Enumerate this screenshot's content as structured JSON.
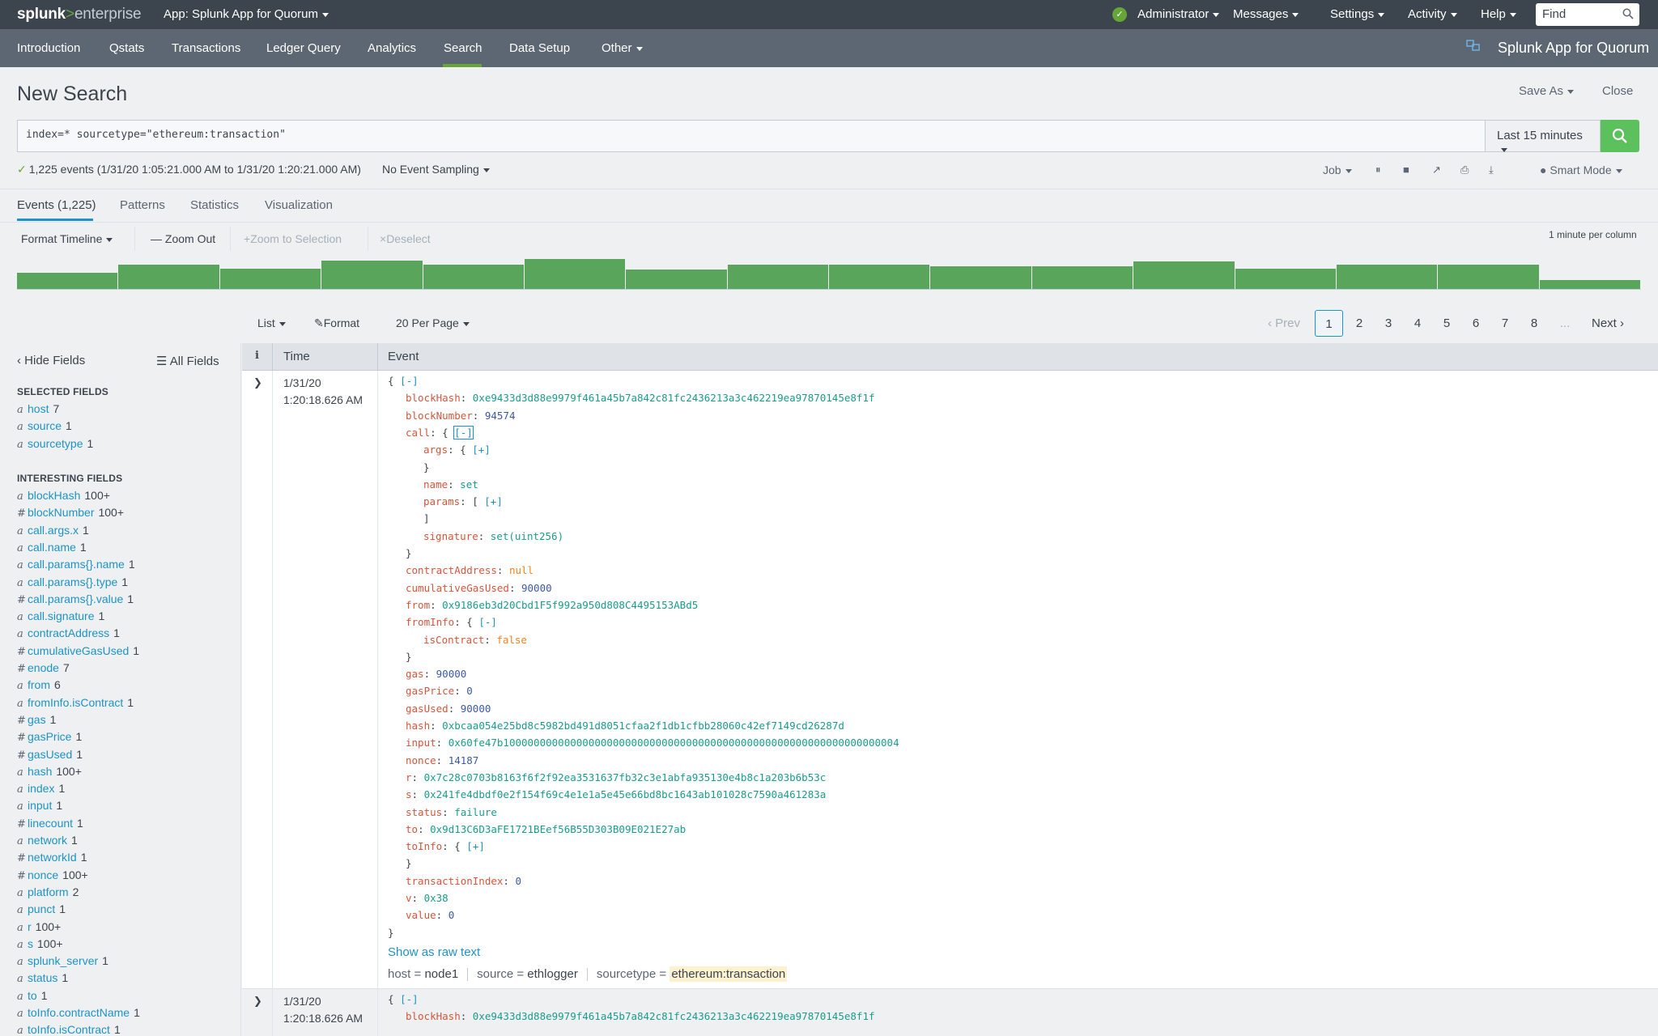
{
  "topbar": {
    "logo_brand": "splunk",
    "logo_gt": ">",
    "logo_product": "enterprise",
    "app_menu": "App: Splunk App for Quorum",
    "menus": [
      "Administrator",
      "Messages",
      "Settings",
      "Activity",
      "Help"
    ],
    "find_placeholder": "Find"
  },
  "appnav": {
    "items": [
      "Introduction",
      "Qstats",
      "Transactions",
      "Ledger Query",
      "Analytics",
      "Search",
      "Data Setup",
      "Other"
    ],
    "active": "Search",
    "app_title": "Splunk App for Quorum"
  },
  "header": {
    "title": "New Search",
    "save_as": "Save As",
    "close": "Close"
  },
  "search": {
    "query": "index=* sourcetype=\"ethereum:transaction\"",
    "time_range": "Last 15 minutes"
  },
  "status": {
    "summary": "1,225 events (1/31/20 1:05:21.000 AM to 1/31/20 1:20:21.000 AM)",
    "sampling": "No Event Sampling",
    "job": "Job",
    "mode": "Smart Mode"
  },
  "tabs": [
    "Events (1,225)",
    "Patterns",
    "Statistics",
    "Visualization"
  ],
  "timeline": {
    "format": "Format Timeline",
    "zoom_out": "Zoom Out",
    "zoom_selection": "Zoom to Selection",
    "deselect": "Deselect",
    "scale": "1 minute per column",
    "bars": [
      0.55,
      0.82,
      0.68,
      0.95,
      0.8,
      1.0,
      0.65,
      0.82,
      0.8,
      0.75,
      0.75,
      0.92,
      0.68,
      0.82,
      0.8,
      0.3
    ]
  },
  "results_toolbar": {
    "list": "List",
    "format": "Format",
    "per_page": "20 Per Page",
    "prev": "Prev",
    "pages": [
      "1",
      "2",
      "3",
      "4",
      "5",
      "6",
      "7",
      "8",
      "..."
    ],
    "next": "Next"
  },
  "sidebar": {
    "hide_fields": "Hide Fields",
    "all_fields": "All Fields",
    "selected_title": "SELECTED FIELDS",
    "selected": [
      {
        "type": "a",
        "name": "host",
        "count": "7"
      },
      {
        "type": "a",
        "name": "source",
        "count": "1"
      },
      {
        "type": "a",
        "name": "sourcetype",
        "count": "1"
      }
    ],
    "interesting_title": "INTERESTING FIELDS",
    "interesting": [
      {
        "type": "a",
        "name": "blockHash",
        "count": "100+"
      },
      {
        "type": "#",
        "name": "blockNumber",
        "count": "100+"
      },
      {
        "type": "a",
        "name": "call.args.x",
        "count": "1"
      },
      {
        "type": "a",
        "name": "call.name",
        "count": "1"
      },
      {
        "type": "a",
        "name": "call.params{}.name",
        "count": "1"
      },
      {
        "type": "a",
        "name": "call.params{}.type",
        "count": "1"
      },
      {
        "type": "#",
        "name": "call.params{}.value",
        "count": "1"
      },
      {
        "type": "a",
        "name": "call.signature",
        "count": "1"
      },
      {
        "type": "a",
        "name": "contractAddress",
        "count": "1"
      },
      {
        "type": "#",
        "name": "cumulativeGasUsed",
        "count": "1"
      },
      {
        "type": "#",
        "name": "enode",
        "count": "7"
      },
      {
        "type": "a",
        "name": "from",
        "count": "6"
      },
      {
        "type": "a",
        "name": "fromInfo.isContract",
        "count": "1"
      },
      {
        "type": "#",
        "name": "gas",
        "count": "1"
      },
      {
        "type": "#",
        "name": "gasPrice",
        "count": "1"
      },
      {
        "type": "#",
        "name": "gasUsed",
        "count": "1"
      },
      {
        "type": "a",
        "name": "hash",
        "count": "100+"
      },
      {
        "type": "a",
        "name": "index",
        "count": "1"
      },
      {
        "type": "a",
        "name": "input",
        "count": "1"
      },
      {
        "type": "#",
        "name": "linecount",
        "count": "1"
      },
      {
        "type": "a",
        "name": "network",
        "count": "1"
      },
      {
        "type": "#",
        "name": "networkId",
        "count": "1"
      },
      {
        "type": "#",
        "name": "nonce",
        "count": "100+"
      },
      {
        "type": "a",
        "name": "platform",
        "count": "2"
      },
      {
        "type": "a",
        "name": "punct",
        "count": "1"
      },
      {
        "type": "a",
        "name": "r",
        "count": "100+"
      },
      {
        "type": "a",
        "name": "s",
        "count": "100+"
      },
      {
        "type": "a",
        "name": "splunk_server",
        "count": "1"
      },
      {
        "type": "a",
        "name": "status",
        "count": "1"
      },
      {
        "type": "a",
        "name": "to",
        "count": "1"
      },
      {
        "type": "a",
        "name": "toInfo.contractName",
        "count": "1"
      },
      {
        "type": "a",
        "name": "toInfo.isContract",
        "count": "1"
      }
    ]
  },
  "table": {
    "col_info": "i",
    "col_time": "Time",
    "col_event": "Event"
  },
  "events": [
    {
      "date": "1/31/20",
      "time": "1:20:18.626 AM",
      "lines": [
        {
          "indent": 0,
          "open": "{",
          "toggle": "[-]"
        },
        {
          "indent": 1,
          "key": "blockHash",
          "val": "0xe9433d3d88e9979f461a45b7a842c81fc2436213a3c462219ea97870145e8f1f",
          "vt": "s"
        },
        {
          "indent": 1,
          "key": "blockNumber",
          "val": "94574",
          "vt": "n"
        },
        {
          "indent": 1,
          "key": "call",
          "open": "{",
          "toggle": "[-]",
          "boxed": true
        },
        {
          "indent": 2,
          "key": "args",
          "open": "{",
          "toggle": "[+]"
        },
        {
          "indent": 2,
          "close": "}"
        },
        {
          "indent": 2,
          "key": "name",
          "val": "set",
          "vt": "s"
        },
        {
          "indent": 2,
          "key": "params",
          "open": "[",
          "toggle": "[+]"
        },
        {
          "indent": 2,
          "close": "]"
        },
        {
          "indent": 2,
          "key": "signature",
          "val": "set(uint256)",
          "vt": "s"
        },
        {
          "indent": 1,
          "close": "}"
        },
        {
          "indent": 1,
          "key": "contractAddress",
          "val": "null",
          "vt": "b"
        },
        {
          "indent": 1,
          "key": "cumulativeGasUsed",
          "val": "90000",
          "vt": "n"
        },
        {
          "indent": 1,
          "key": "from",
          "val": "0x9186eb3d20Cbd1F5f992a950d808C4495153ABd5",
          "vt": "s"
        },
        {
          "indent": 1,
          "key": "fromInfo",
          "open": "{",
          "toggle": "[-]"
        },
        {
          "indent": 2,
          "key": "isContract",
          "val": "false",
          "vt": "b"
        },
        {
          "indent": 1,
          "close": "}"
        },
        {
          "indent": 1,
          "key": "gas",
          "val": "90000",
          "vt": "n"
        },
        {
          "indent": 1,
          "key": "gasPrice",
          "val": "0",
          "vt": "n"
        },
        {
          "indent": 1,
          "key": "gasUsed",
          "val": "90000",
          "vt": "n"
        },
        {
          "indent": 1,
          "key": "hash",
          "val": "0xbcaa054e25bd8c5982bd491d8051cfaa2f1db1cfbb28060c42ef7149cd26287d",
          "vt": "s"
        },
        {
          "indent": 1,
          "key": "input",
          "val": "0x60fe47b10000000000000000000000000000000000000000000000000000000000000004",
          "vt": "s"
        },
        {
          "indent": 1,
          "key": "nonce",
          "val": "14187",
          "vt": "n"
        },
        {
          "indent": 1,
          "key": "r",
          "val": "0x7c28c0703b8163f6f2f92ea3531637fb32c3e1abfa935130e4b8c1a203b6b53c",
          "vt": "s"
        },
        {
          "indent": 1,
          "key": "s",
          "val": "0x241fe4dbdf0e2f154f69c4e1e1a5e45e66bd8bc1643ab101028c7590a461283a",
          "vt": "s"
        },
        {
          "indent": 1,
          "key": "status",
          "val": "failure",
          "vt": "s"
        },
        {
          "indent": 1,
          "key": "to",
          "val": "0x9d13C6D3aFE1721BEef56B55D303B09E021E27ab",
          "vt": "s"
        },
        {
          "indent": 1,
          "key": "toInfo",
          "open": "{",
          "toggle": "[+]"
        },
        {
          "indent": 1,
          "close": "}"
        },
        {
          "indent": 1,
          "key": "transactionIndex",
          "val": "0",
          "vt": "n"
        },
        {
          "indent": 1,
          "key": "v",
          "val": "0x38",
          "vt": "s"
        },
        {
          "indent": 1,
          "key": "value",
          "val": "0",
          "vt": "n"
        },
        {
          "indent": 0,
          "close": "}"
        }
      ],
      "show_raw": "Show as raw text",
      "meta": [
        {
          "label": "host =",
          "value": "node1"
        },
        {
          "label": "source =",
          "value": "ethlogger"
        },
        {
          "label": "sourcetype =",
          "value": "ethereum:transaction"
        }
      ]
    },
    {
      "date": "1/31/20",
      "time": "1:20:18.626 AM",
      "lines": [
        {
          "indent": 0,
          "open": "{",
          "toggle": "[-]"
        },
        {
          "indent": 1,
          "key": "blockHash",
          "val": "0xe9433d3d88e9979f461a45b7a842c81fc2436213a3c462219ea97870145e8f1f",
          "vt": "s"
        }
      ]
    }
  ]
}
